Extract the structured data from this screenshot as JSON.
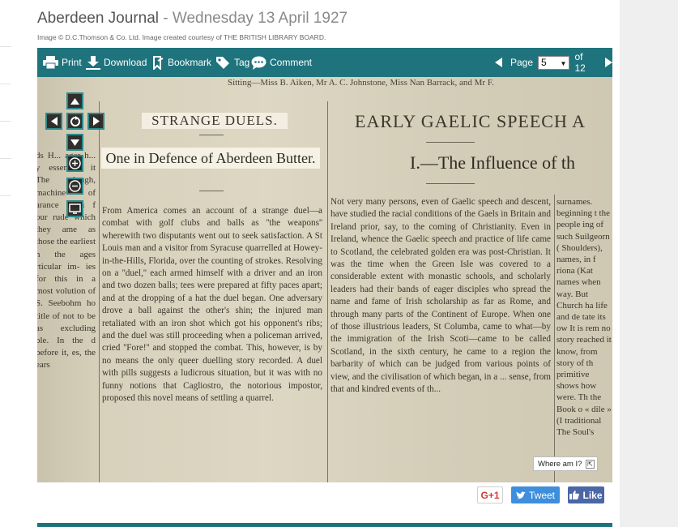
{
  "header": {
    "publication": "Aberdeen Journal",
    "separator": " - ",
    "date": "Wednesday 13 April 1927",
    "credit": "Image © D.C.Thomson & Co. Ltd. Image created courtesy of THE BRITISH LIBRARY BOARD."
  },
  "toolbar": {
    "print_label": "Print",
    "download_label": "Download",
    "bookmark_label": "Bookmark",
    "tag_label": "Tag",
    "comment_label": "Comment",
    "page_label": "Page",
    "page_value": "5",
    "page_total": "of 12",
    "accent_color": "#1f737c"
  },
  "newspaper": {
    "topline": "Sitting—Miss B. Aiken, Mr A. C. Johnstone, Miss Nan Barrack, and Mr F.",
    "left_column_text": "ds H... ager h... y essentiali it The plough, machine of arance from f our rude which they ame as those the earliest n the ages rticular im- ies for this in a most volution of S. Seebohm ho title of not to be as excluding ble. In the d before it, es, the ears",
    "article1_heading": "STRANGE DUELS.",
    "article1_subheading": "One in Defence of Aberdeen Butter.",
    "article1_body": "From America comes an account of a strange duel—a combat with golf clubs and balls as ''the weapons'' wherewith two disputants went out to seek satisfaction. A St Louis man and a visitor from Syracuse quarrelled at Howey-in-the-Hills, Florida, over the counting of strokes. Resolving on a ''duel,'' each armed himself with a driver and an iron and two dozen balls; tees were prepared at fifty paces apart; and at the dropping of a hat the duel began. One adversary drove a ball against the other's shin; the injured man retaliated with an iron shot which got his opponent's ribs; and the duel was still proceeding when a policeman arrived, cried ''Fore!'' and stopped the combat. This, however, is by no means the only queer duelling story recorded. A duel with pills suggests a ludicrous situation, but it was with no funny notions that Cagliostro, the notorious impostor, proposed this novel means of settling a quarrel.",
    "article2_heading": "EARLY GAELIC SPEECH A",
    "article2_subheading": "I.—The Influence of th",
    "article2_body": "Not very many persons, even of Gaelic speech and descent, have studied the racial conditions of the Gaels in Britain and Ireland prior, say, to the coming of Christianity. Even in Ireland, whence the Gaelic speech and practice of life came to Scotland, the celebrated golden era was post-Christian. It was the time when the Green Isle was covered to a considerable extent with monastic schools, and scholarly leaders had their bands of eager disciples who spread the name and fame of Irish scholarship as far as Rome, and through many parts of the Continent of Europe. When one of those illustrious leaders, St Columba, came to what—by the immigration of the Irish Scoti—came to be called Scotland, in the sixth century, he came to a region the barbarity of which can be judged from various points of view, and the civilisation of which began, in a ... sense, from that and kindred events of th...",
    "article3_body": "surnames. beginning t the people ing of such Suilgeorn ( Shoulders), names, in f riona (Kat names when way. But Church ha life and de tate its ow It is rem no story reached it know, from story of th primitive shows how were. Th the Book o « dile » (I traditional The Soul's"
  },
  "viewer": {
    "where_am_i": "Where am I?"
  },
  "social": {
    "gplus_label": "G+1",
    "tweet_label": "Tweet",
    "like_label": "Like",
    "tweet_color": "#3d8fdc",
    "like_color": "#4a67a6"
  }
}
